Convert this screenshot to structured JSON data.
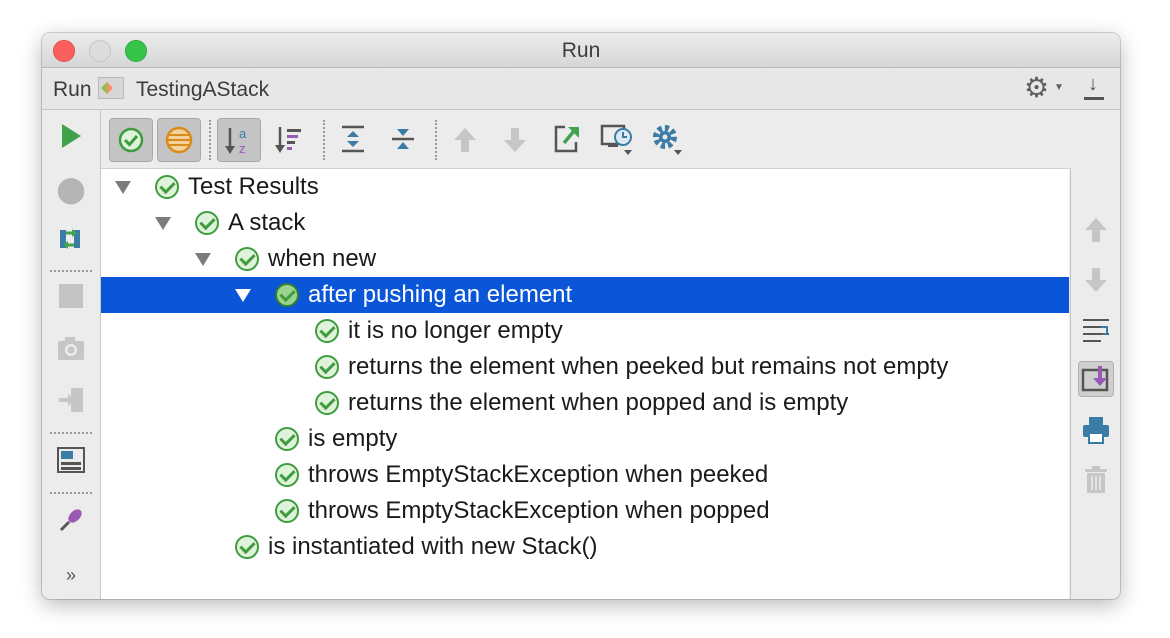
{
  "window": {
    "title": "Run"
  },
  "run_bar": {
    "label": "Run",
    "config_name": "TestingAStack"
  },
  "colors": {
    "selection": "#0a55d8",
    "pass": "#3e9c3e",
    "run_green": "#3fa34d"
  },
  "tree": {
    "rows": [
      {
        "label": "Test Results"
      },
      {
        "label": "A stack"
      },
      {
        "label": "when new"
      },
      {
        "label": "after pushing an element",
        "selected": true
      },
      {
        "label": "it is no longer empty"
      },
      {
        "label": "returns the element when peeked but remains not empty"
      },
      {
        "label": "returns the element when popped and is empty"
      },
      {
        "label": "is empty"
      },
      {
        "label": "throws EmptyStackException when peeked"
      },
      {
        "label": "throws EmptyStackException when popped"
      },
      {
        "label": "is instantiated with new Stack()"
      }
    ]
  },
  "left_toolbar": {
    "more_label": "»"
  },
  "icons": {
    "left": [
      "play-icon",
      "debug-icon",
      "rerun-failed-icon",
      "stop-icon",
      "camera-icon",
      "exit-icon",
      "layout-icon",
      "pin-icon"
    ],
    "toolbar": [
      "show-passed-icon",
      "show-ignored-icon",
      "sort-alpha-icon",
      "sort-duration-icon",
      "expand-all-icon",
      "collapse-all-icon",
      "previous-failed-icon",
      "next-failed-icon",
      "export-icon",
      "history-icon",
      "settings-icon"
    ],
    "right": [
      "up-arrow-icon",
      "down-arrow-icon",
      "soft-wrap-icon",
      "scroll-to-end-icon",
      "print-icon",
      "trash-icon"
    ]
  }
}
